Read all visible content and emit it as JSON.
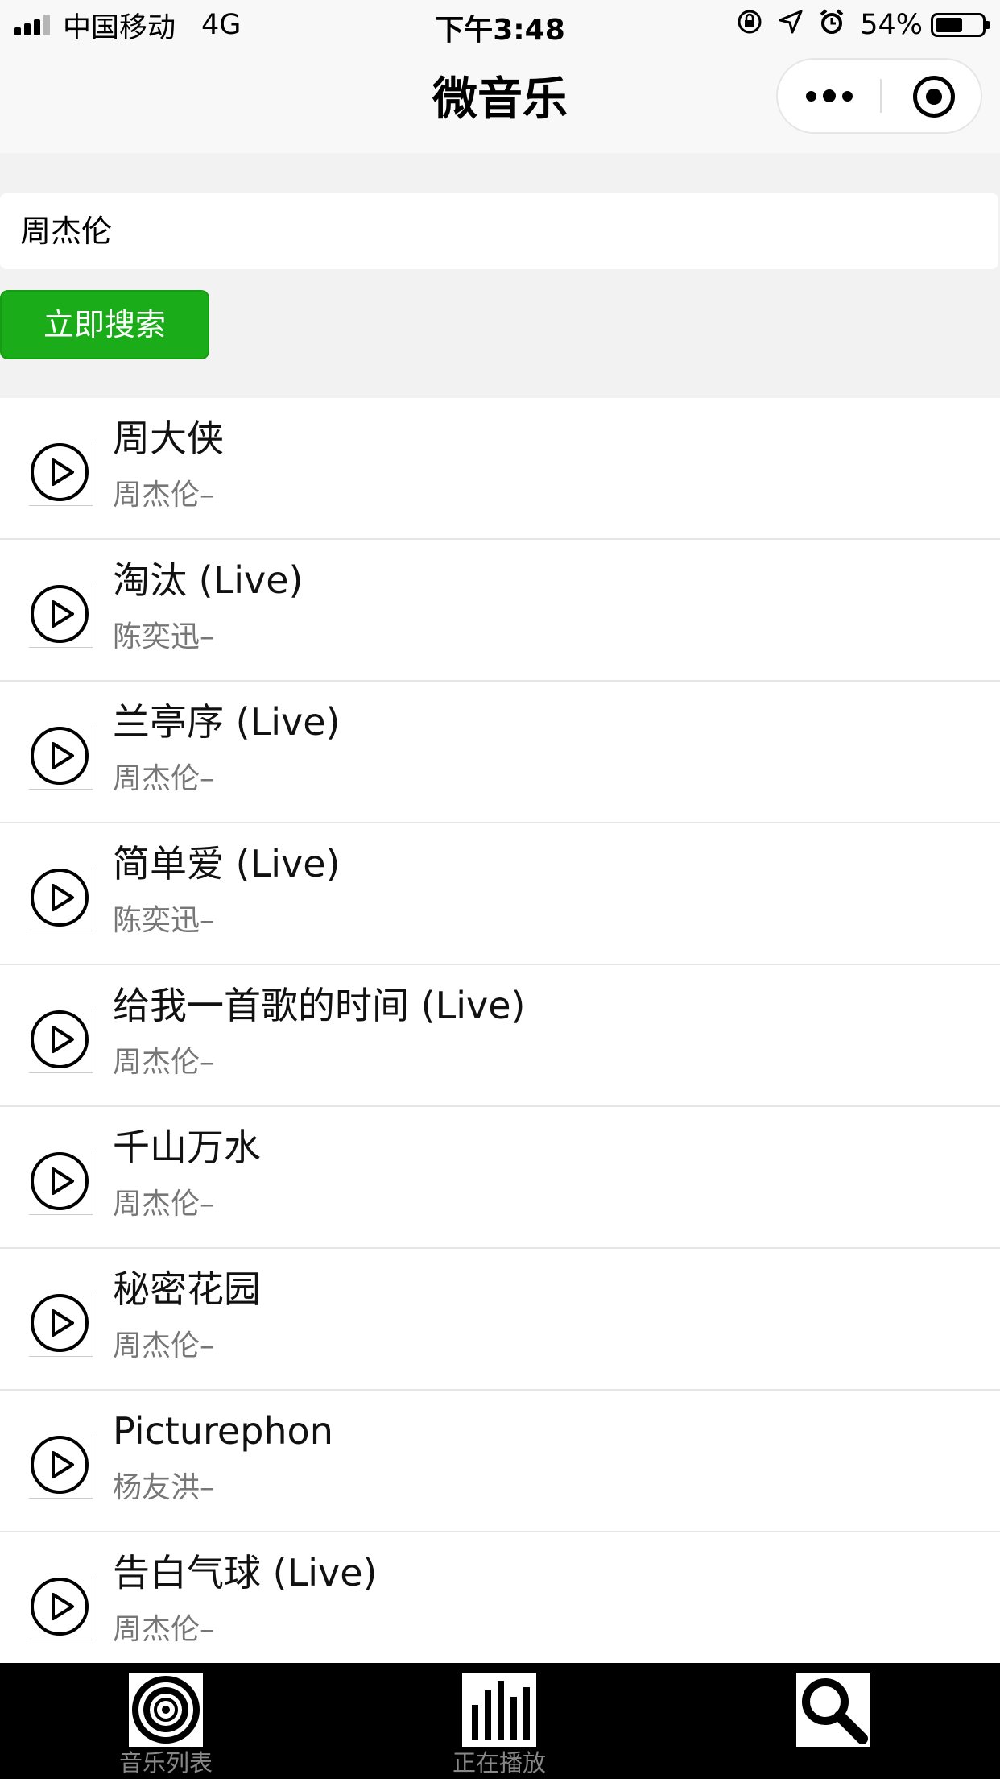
{
  "status_bar": {
    "carrier": "中国移动",
    "network": "4G",
    "time": "下午3:48",
    "battery": "54%"
  },
  "nav": {
    "title": "微音乐"
  },
  "search": {
    "value": "周杰伦",
    "button_label": "立即搜索"
  },
  "songs": [
    {
      "title": "周大侠",
      "artist": "周杰伦–"
    },
    {
      "title": "淘汰 (Live)",
      "artist": "陈奕迅–"
    },
    {
      "title": "兰亭序 (Live)",
      "artist": "周杰伦–"
    },
    {
      "title": "简单爱 (Live)",
      "artist": "陈奕迅–"
    },
    {
      "title": "给我一首歌的时间 (Live)",
      "artist": "周杰伦–"
    },
    {
      "title": "千山万水",
      "artist": "周杰伦–"
    },
    {
      "title": "秘密花园",
      "artist": "周杰伦–"
    },
    {
      "title": "Picturephon",
      "artist": "杨友洪–"
    },
    {
      "title": "告白气球 (Live)",
      "artist": "周杰伦–"
    }
  ],
  "tabs": [
    {
      "label": "音乐列表",
      "icon": "vinyl-icon"
    },
    {
      "label": "正在播放",
      "icon": "equalizer-icon"
    },
    {
      "label": "",
      "icon": "search-icon"
    }
  ],
  "colors": {
    "accent": "#1aad19",
    "tab_bar_bg": "#000000",
    "search_area_bg": "#f2f2f2"
  }
}
